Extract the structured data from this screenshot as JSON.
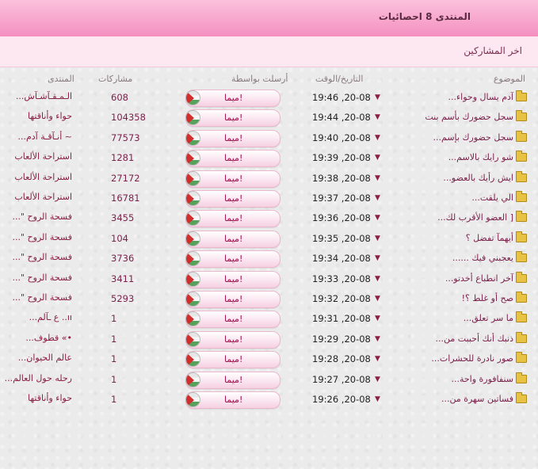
{
  "header": {
    "title": "المنتدى 8 احصائيات",
    "subtitle": "اخر المشاركين"
  },
  "columns": {
    "topic": "الموضوع",
    "date": "التاريخ/الوقت",
    "sender": "أرسلت بواسطة",
    "posts": "مشاركات",
    "forum": "المنتدى"
  },
  "icons": {
    "folder": "folder-icon",
    "caret": "caret-down-icon",
    "flag": "flag-icon",
    "caret_glyph": "▼"
  },
  "rows": [
    {
      "topic": "آدم يسال وحواء...",
      "date": "19:46 ,20-08",
      "sender": "ميما!",
      "posts": "608",
      "forum": "الـمـقـآشـآش..."
    },
    {
      "topic": "سجل حضورك بأسم بنت",
      "date": "19:44 ,20-08",
      "sender": "ميما!",
      "posts": "104358",
      "forum": "حواء وأناقتها"
    },
    {
      "topic": "سجل حضورك بإسم...",
      "date": "19:40 ,20-08",
      "sender": "ميما!",
      "posts": "77573",
      "forum": "~ أنـآقـة آدم..."
    },
    {
      "topic": "شو رايك بالاسم...",
      "date": "19:39 ,20-08",
      "sender": "ميما!",
      "posts": "1281",
      "forum": "استراحة الألعاب"
    },
    {
      "topic": "ايش رأيك بالعضو...",
      "date": "19:38 ,20-08",
      "sender": "ميما!",
      "posts": "27172",
      "forum": "استراحة الألعاب"
    },
    {
      "topic": "الي يلقت...",
      "date": "19:37 ,20-08",
      "sender": "ميما!",
      "posts": "16781",
      "forum": "استراحة الألعاب"
    },
    {
      "topic": "[ العضو الأقرب لك...",
      "date": "19:36 ,20-08",
      "sender": "ميما!",
      "posts": "3455",
      "forum": "فسحة الروح \"..."
    },
    {
      "topic": "أيهمآ تفضل ؟",
      "date": "19:35 ,20-08",
      "sender": "ميما!",
      "posts": "104",
      "forum": "فسحة الروح \"..."
    },
    {
      "topic": "يعجبني فيك ......",
      "date": "19:34 ,20-08",
      "sender": "ميما!",
      "posts": "3736",
      "forum": "فسحة الروح \"..."
    },
    {
      "topic": "آخر انطباع أخدتو...",
      "date": "19:33 ,20-08",
      "sender": "ميما!",
      "posts": "3411",
      "forum": "فسحة الروح \"..."
    },
    {
      "topic": "صح أو غلط ؟!",
      "date": "19:32 ,20-08",
      "sender": "ميما!",
      "posts": "5293",
      "forum": "فسحة الروح \"..."
    },
    {
      "topic": "ما سر تعلق...",
      "date": "19:31 ,20-08",
      "sender": "ميما!",
      "posts": "1",
      "forum": "ıı.. ع ـآلم..."
    },
    {
      "topic": "ذنبك أنك أحببت من...",
      "date": "19:29 ,20-08",
      "sender": "ميما!",
      "posts": "1",
      "forum": "•» قطوف..."
    },
    {
      "topic": "صور نادرة للحشرات...",
      "date": "19:28 ,20-08",
      "sender": "ميما!",
      "posts": "1",
      "forum": "عالم الحيوان..."
    },
    {
      "topic": "سنفافورة واحة...",
      "date": "19:27 ,20-08",
      "sender": "ميما!",
      "posts": "1",
      "forum": "رحله حول العالم..."
    },
    {
      "topic": "فساتين سهرة من...",
      "date": "19:26 ,20-08",
      "sender": "ميما!",
      "posts": "1",
      "forum": "حواء وأناقتها"
    }
  ]
}
